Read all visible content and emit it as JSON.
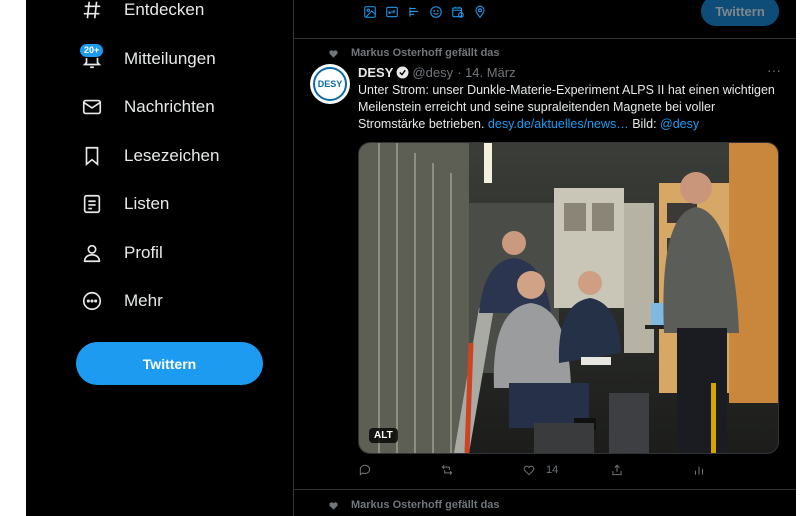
{
  "sidebar": {
    "items": [
      {
        "label": "Entdecken",
        "icon": "hashtag-icon"
      },
      {
        "label": "Mitteilungen",
        "icon": "bell-icon",
        "badge": "20+"
      },
      {
        "label": "Nachrichten",
        "icon": "envelope-icon"
      },
      {
        "label": "Lesezeichen",
        "icon": "bookmark-icon"
      },
      {
        "label": "Listen",
        "icon": "list-icon"
      },
      {
        "label": "Profil",
        "icon": "person-icon"
      },
      {
        "label": "Mehr",
        "icon": "more-circle-icon"
      }
    ],
    "tweet_button": "Twittern"
  },
  "compose": {
    "icons": [
      "image-icon",
      "gif-icon",
      "poll-icon",
      "emoji-icon",
      "schedule-icon",
      "location-icon"
    ],
    "tweet_button": "Twittern"
  },
  "tweet": {
    "social_context": "Markus Osterhoff gefällt das",
    "author": "DESY",
    "handle": "@desy",
    "date": "· 14. März",
    "avatar_text": "DESY",
    "text_main": "Unter Strom: unser Dunkle-Materie-Experiment ALPS II hat einen wichtigen Meilenstein erreicht und seine supraleitenden Magnete bei voller Stromstärke betrieben. ",
    "link": "desy.de/aktuelles/news…",
    "text_after": " Bild: ",
    "mention": "@desy",
    "alt_badge": "ALT",
    "more": "···",
    "likes": "14",
    "accent": "#1d9bf0"
  },
  "next_tweet": {
    "social_context": "Markus Osterhoff gefällt das"
  }
}
